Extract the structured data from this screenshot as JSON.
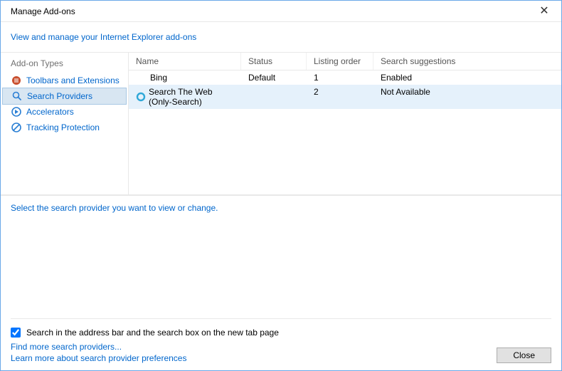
{
  "titlebar": {
    "title": "Manage Add-ons"
  },
  "subtitle": {
    "link": "View and manage your Internet Explorer add-ons"
  },
  "sidebar": {
    "header": "Add-on Types",
    "items": [
      {
        "label": "Toolbars and Extensions"
      },
      {
        "label": "Search Providers"
      },
      {
        "label": "Accelerators"
      },
      {
        "label": "Tracking Protection"
      }
    ]
  },
  "columns": {
    "name": "Name",
    "status": "Status",
    "order": "Listing order",
    "suggestions": "Search suggestions"
  },
  "rows": [
    {
      "name": "Bing",
      "status": "Default",
      "order": "1",
      "suggestions": "Enabled",
      "icon": ""
    },
    {
      "name": "Search The Web (Only-Search)",
      "status": "",
      "order": "2",
      "suggestions": "Not Available",
      "icon": "ring"
    }
  ],
  "bottom": {
    "instruction": "Select the search provider you want to view or change.",
    "checkbox_label": "Search in the address bar and the search box on the new tab page"
  },
  "footer": {
    "link1": "Find more search providers...",
    "link2": "Learn more about search provider preferences",
    "close": "Close"
  }
}
